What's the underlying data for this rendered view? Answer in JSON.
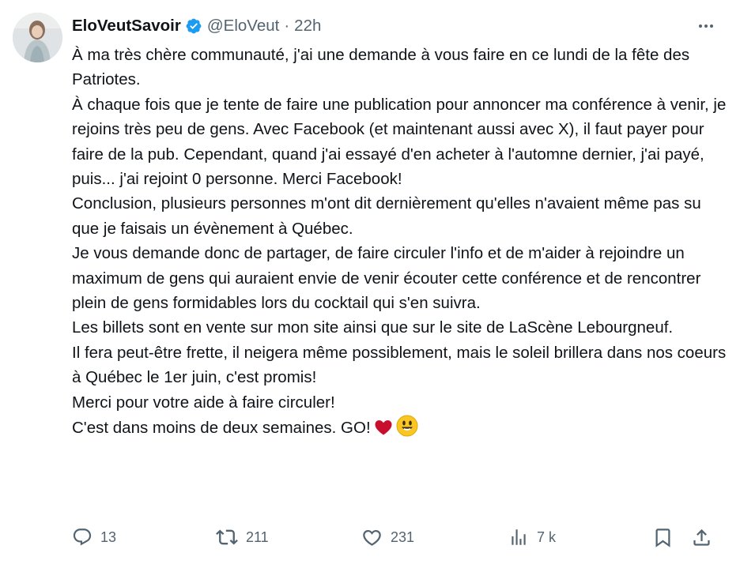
{
  "author": {
    "display_name": "EloVeutSavoir",
    "handle": "@EloVeut",
    "separator": "·",
    "time": "22h",
    "verified": true,
    "verified_color": "#1d9bf0"
  },
  "tweet": {
    "lines": [
      "À ma très chère communauté, j'ai une demande à vous faire en ce lundi de la fête des Patriotes.",
      "À chaque fois que je tente de faire une publication pour annoncer ma conférence à venir, je rejoins très peu de gens. Avec Facebook (et maintenant aussi avec X), il faut payer pour faire de la pub. Cependant, quand j'ai essayé d'en acheter à l'automne dernier, j'ai payé, puis... j'ai rejoint 0 personne. Merci Facebook!",
      "Conclusion, plusieurs personnes m'ont dit dernièrement qu'elles n'avaient même pas su que je faisais un évènement à Québec.",
      "Je vous demande donc de partager, de faire circuler l'info et de m'aider à rejoindre un maximum de gens qui auraient envie de venir écouter cette conférence et de rencontrer plein de gens formidables lors du cocktail qui s'en suivra.",
      "Les billets sont en vente sur mon site ainsi que sur le site de LaScène Lebourgneuf.",
      "Il fera peut-être frette, il neigera même possiblement, mais le soleil brillera dans nos coeurs à Québec le 1er juin, c'est promis!",
      "Merci pour votre aide à faire circuler!"
    ],
    "last_line": "C'est dans moins de deux semaines. GO!",
    "last_line_emojis": [
      "red-heart-icon",
      "smiling-face-icon"
    ]
  },
  "actions": {
    "replies": "13",
    "reposts": "211",
    "likes": "231",
    "views": "7 k"
  },
  "colors": {
    "text": "#0f1419",
    "secondary": "#536471",
    "verified": "#1d9bf0",
    "heart": "#c8102e",
    "smiley": "#f9c623"
  }
}
